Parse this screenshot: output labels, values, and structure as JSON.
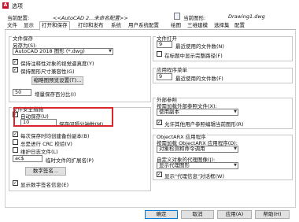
{
  "window": {
    "title": "选项",
    "app_icon_letter": "A"
  },
  "info": {
    "profile_label": "当前配置:",
    "profile_value": "<<AutoCAD 2...未命名配置>>",
    "drawing_label": "当前图形:",
    "drawing_value": "Drawing1.dwg"
  },
  "tabs": [
    "文件",
    "显示",
    "打开和保存",
    "打印和发布",
    "系统",
    "用户系统配置",
    "绘图",
    "三维建模",
    "选择集",
    "配置"
  ],
  "active_tab": "打开和保存",
  "file_save": {
    "title": "文件保存",
    "saveas_label": "另存为(S):",
    "saveas_value": "AutoCAD 2018 图形 (*.dwg)",
    "keep_annotative": "保持注释性对象的视觉逼真度(Y)",
    "maintain_size": "保持图形尺寸兼容性(G)",
    "thumbnail_button": "缩略图预览设置(T)...",
    "incremental_value": "50",
    "incremental_label": "增量保存百分比(I)"
  },
  "safety": {
    "title": "文件安全措施",
    "autosave": "自动保存(U)",
    "autosave_minutes": "10",
    "minutes_label": "保存间隔分钟数(M)",
    "backup_each_save": "每次保存时均创建备份副本(B)",
    "crc": "总是进行 CRC 校验(V)",
    "log_file": "维护日志文件(L)",
    "temp_ext_value": "ac$",
    "temp_ext_label": "临时文件的扩展名(P)",
    "signature_button": "数字签名...",
    "show_signature": "显示数字签名信息(E)"
  },
  "file_open": {
    "title": "文件打开",
    "recent_count": "9",
    "recent_label": "最近使用的文件数(N)",
    "full_path": "在标题中显示完整路径(F)"
  },
  "app_menu": {
    "title": "应用程序菜单",
    "recent_count": "9",
    "recent_label": "最近使用的文件数(F)"
  },
  "xref": {
    "title": "外部参照",
    "demand_label": "按需加载外部参照文件(X):",
    "demand_value": "使用副本",
    "allow_edit": "允许其他用户参照编辑当前图形(R)"
  },
  "objectarx": {
    "title": "ObjectARX 应用程序",
    "demand_label": "按需加载 ObjectARX 应用程序(D):",
    "demand_value": "对象检测和命令调用",
    "proxy_label": "自定义对象的代理图像(J):",
    "proxy_value": "显示代理图形",
    "show_proxy_info": "显示\"代理信息\"对话框(W)"
  },
  "footer": {
    "ok": "确定",
    "cancel": "取消",
    "apply": "应用(A)",
    "help": "帮助(H)"
  },
  "colors": {
    "highlight": "#d9262b",
    "accent": "#0078d7"
  }
}
